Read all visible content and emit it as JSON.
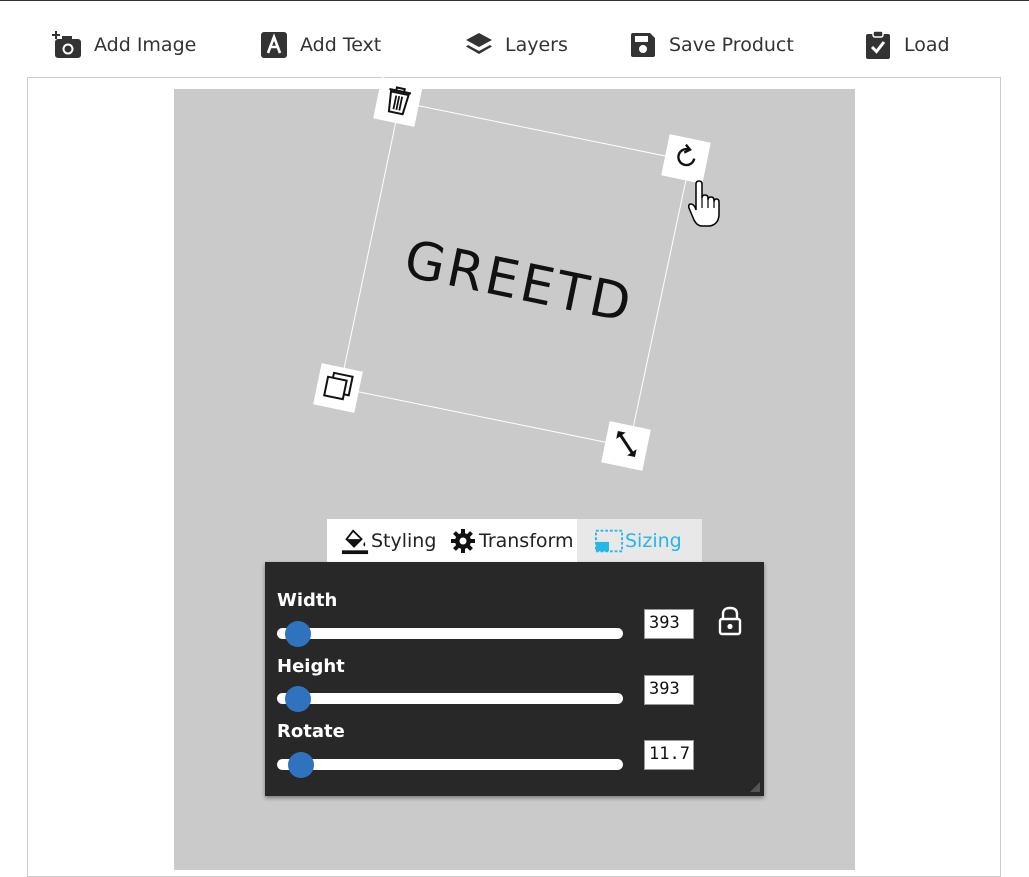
{
  "toolbar": {
    "add_image": "Add Image",
    "add_text": "Add Text",
    "layers": "Layers",
    "save_product": "Save Product",
    "load": "Load"
  },
  "canvas": {
    "text_object": "GREETD",
    "text_rotation_deg": 11.7
  },
  "tabs": {
    "styling": "Styling",
    "transform": "Transform",
    "sizing": "Sizing",
    "active": "Sizing",
    "active_color": "#26b7e6"
  },
  "sizing": {
    "width_label": "Width",
    "width_value": "393",
    "height_label": "Height",
    "height_value": "393",
    "rotate_label": "Rotate",
    "rotate_value": "11.7:",
    "width_slider_fraction": 0.06,
    "height_slider_fraction": 0.06,
    "rotate_slider_fraction": 0.07
  },
  "icons": {
    "delete": "trash-icon",
    "rotate": "rotate-icon",
    "duplicate": "duplicate-icon",
    "resize": "resize-icon",
    "lock": "lock-icon"
  },
  "colors": {
    "canvas_bg": "#cacaca",
    "panel_bg": "#282828",
    "slider_thumb": "#2f72bd"
  }
}
